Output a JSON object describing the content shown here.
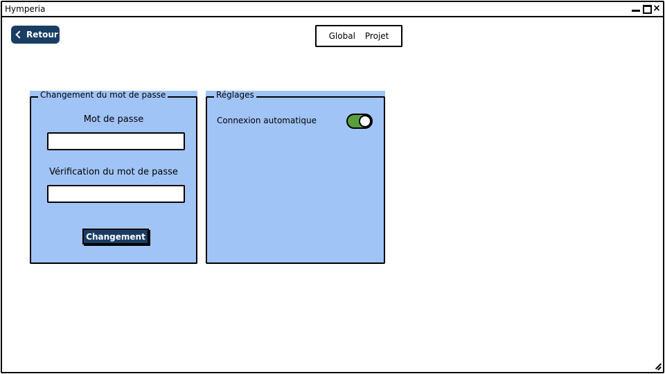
{
  "window": {
    "title": "Hymperia"
  },
  "header": {
    "back_label": "Retour",
    "tabs": [
      {
        "label": "Global"
      },
      {
        "label": "Projet"
      }
    ]
  },
  "password_panel": {
    "legend": "Changement du mot de passe",
    "password_label": "Mot de passe",
    "password_value": "",
    "verify_label": "Vérification du mot de passe",
    "verify_value": "",
    "submit_label": "Changement"
  },
  "settings_panel": {
    "legend": "Réglages",
    "auto_login_label": "Connexion automatique",
    "auto_login_enabled": true
  },
  "colors": {
    "panel_bg": "#a1c4f6",
    "button_bg": "#1a3d64",
    "toggle_on": "#5a9e3e"
  }
}
